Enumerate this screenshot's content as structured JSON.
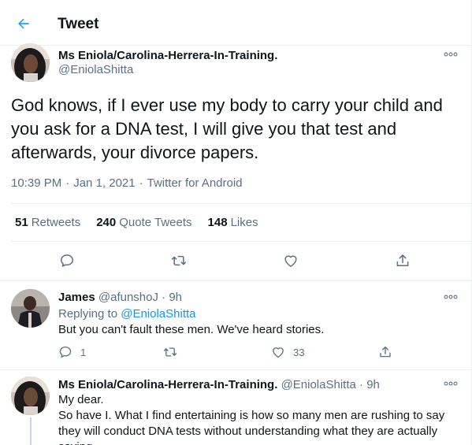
{
  "header": {
    "title": "Tweet"
  },
  "tweet": {
    "author_name": "Ms Eniola/Carolina-Herrera-In-Training.",
    "author_handle": "@EniolaShitta",
    "text": "God knows, if I ever use my body to carry your child and you ask for a DNA test, I will give you that test and afterwards, your divorce papers.",
    "time": "10:39 PM",
    "date": "Jan 1, 2021",
    "source": "Twitter for Android",
    "separator": "·",
    "stats": {
      "retweets_count": "51",
      "retweets_label": "Retweets",
      "quote_count": "240",
      "quote_label": "Quote Tweets",
      "likes_count": "148",
      "likes_label": "Likes"
    }
  },
  "replies": [
    {
      "author_name": "James",
      "author_handle": "@afunshoJ",
      "time": "9h",
      "replying_prefix": "Replying to",
      "replying_to": "@EniolaShitta",
      "text": "But you can't fault these men. We've heard stories.",
      "reply_count": "1",
      "like_count": "33"
    },
    {
      "author_name": "Ms Eniola/Carolina-Herrera-In-Training.",
      "author_handle": "@EniolaShitta",
      "time": "9h",
      "line1": "My dear.",
      "line2": "So have I. What I find entertaining is how so many men are rushing to say they will conduct DNA tests without understanding what they are actually saying."
    }
  ],
  "colors": {
    "accent": "#1da1f2",
    "link": "#1b95e0",
    "muted": "#5b7083",
    "text": "#0f1419",
    "divider": "#ebeef0"
  },
  "icons": [
    "back-arrow-icon",
    "more-icon",
    "reply-icon",
    "retweet-icon",
    "like-icon",
    "share-icon"
  ]
}
